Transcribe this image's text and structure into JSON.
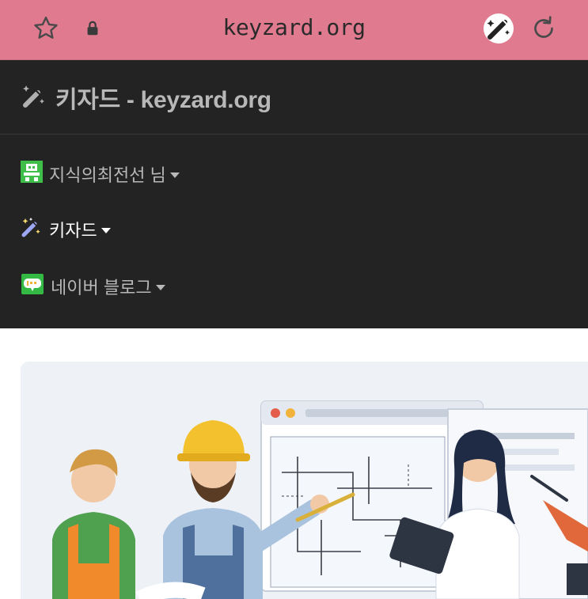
{
  "browser": {
    "url": "keyzard.org",
    "icons": [
      "star-icon",
      "lock-icon",
      "magic-wand-icon",
      "reload-icon"
    ]
  },
  "header": {
    "title": "키자드 - keyzard.org",
    "icon": "magic-wand-icon"
  },
  "menu": {
    "items": [
      {
        "label": "지식의최전선 님",
        "icon": "user-avatar-icon",
        "color": "#b8b8b8"
      },
      {
        "label": "키자드",
        "icon": "magic-wand-icon",
        "color": "#ffffff"
      },
      {
        "label": "네이버 블로그",
        "icon": "blog-icon",
        "color": "#b8b8b8"
      }
    ]
  },
  "hero": {
    "image": "construction-team-illustration"
  },
  "colors": {
    "browser_bar": "#e07a8f",
    "header_bg": "#232323",
    "menu_text": "#b8b8b8",
    "menu_active": "#ffffff"
  }
}
